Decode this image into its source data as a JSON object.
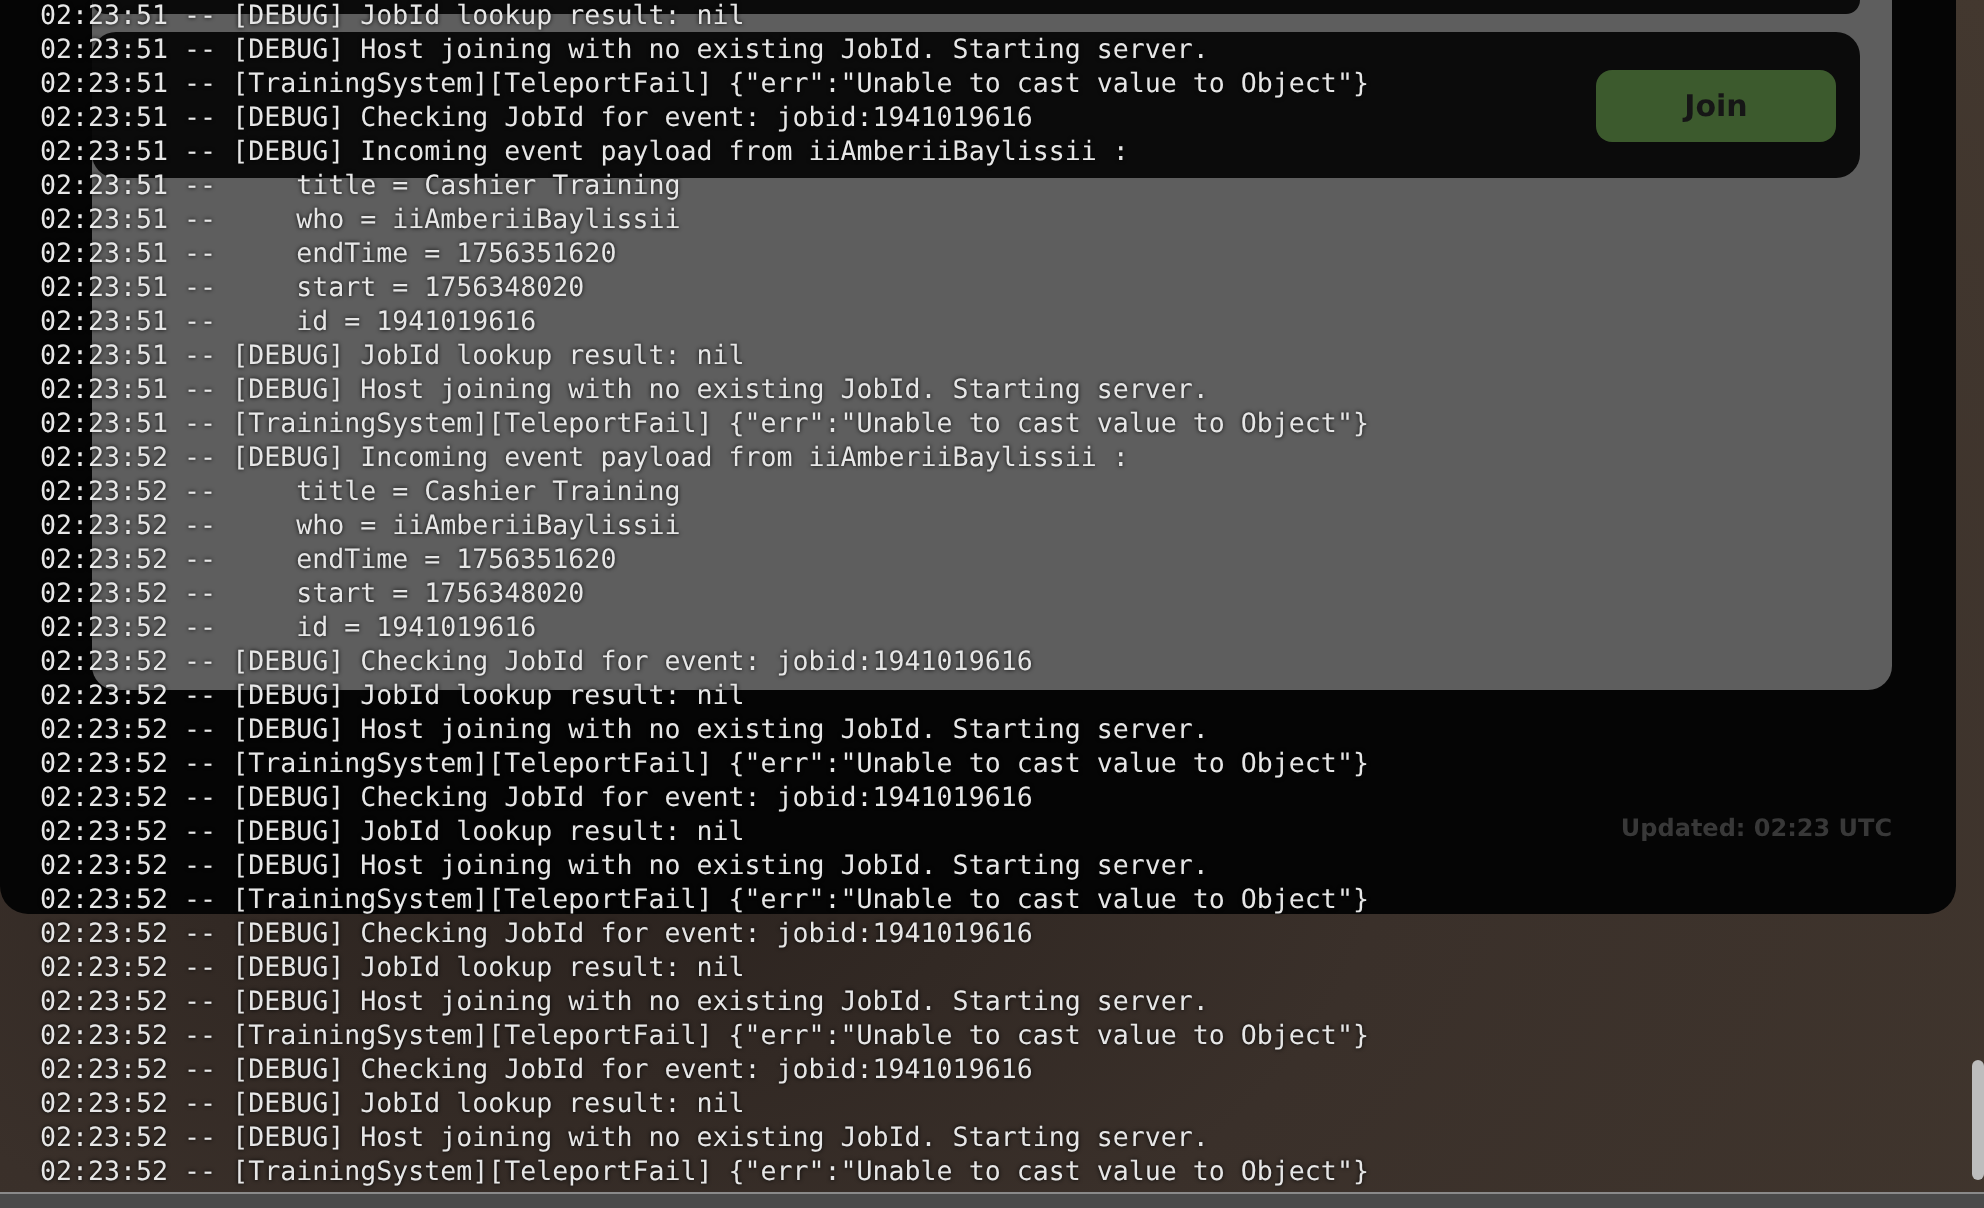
{
  "event_card": {
    "join_button": "Join"
  },
  "updated": "Updated: 02:23 UTC",
  "log_lines": [
    "02:23:51 -- [DEBUG] JobId lookup result: nil",
    "02:23:51 -- [DEBUG] Host joining with no existing JobId. Starting server.",
    "02:23:51 -- [TrainingSystem][TeleportFail] {\"err\":\"Unable to cast value to Object\"}",
    "02:23:51 -- [DEBUG] Checking JobId for event: jobid:1941019616",
    "02:23:51 -- [DEBUG] Incoming event payload from iiAmberiiBaylissii :",
    "02:23:51 --     title = Cashier Training",
    "02:23:51 --     who = iiAmberiiBaylissii",
    "02:23:51 --     endTime = 1756351620",
    "02:23:51 --     start = 1756348020",
    "02:23:51 --     id = 1941019616",
    "02:23:51 -- [DEBUG] JobId lookup result: nil",
    "02:23:51 -- [DEBUG] Host joining with no existing JobId. Starting server.",
    "02:23:51 -- [TrainingSystem][TeleportFail] {\"err\":\"Unable to cast value to Object\"}",
    "02:23:52 -- [DEBUG] Incoming event payload from iiAmberiiBaylissii :",
    "02:23:52 --     title = Cashier Training",
    "02:23:52 --     who = iiAmberiiBaylissii",
    "02:23:52 --     endTime = 1756351620",
    "02:23:52 --     start = 1756348020",
    "02:23:52 --     id = 1941019616",
    "02:23:52 -- [DEBUG] Checking JobId for event: jobid:1941019616",
    "02:23:52 -- [DEBUG] JobId lookup result: nil",
    "02:23:52 -- [DEBUG] Host joining with no existing JobId. Starting server.",
    "02:23:52 -- [TrainingSystem][TeleportFail] {\"err\":\"Unable to cast value to Object\"}",
    "02:23:52 -- [DEBUG] Checking JobId for event: jobid:1941019616",
    "02:23:52 -- [DEBUG] JobId lookup result: nil",
    "02:23:52 -- [DEBUG] Host joining with no existing JobId. Starting server.",
    "02:23:52 -- [TrainingSystem][TeleportFail] {\"err\":\"Unable to cast value to Object\"}",
    "02:23:52 -- [DEBUG] Checking JobId for event: jobid:1941019616",
    "02:23:52 -- [DEBUG] JobId lookup result: nil",
    "02:23:52 -- [DEBUG] Host joining with no existing JobId. Starting server.",
    "02:23:52 -- [TrainingSystem][TeleportFail] {\"err\":\"Unable to cast value to Object\"}",
    "02:23:52 -- [DEBUG] Checking JobId for event: jobid:1941019616",
    "02:23:52 -- [DEBUG] JobId lookup result: nil",
    "02:23:52 -- [DEBUG] Host joining with no existing JobId. Starting server.",
    "02:23:52 -- [TrainingSystem][TeleportFail] {\"err\":\"Unable to cast value to Object\"}"
  ]
}
